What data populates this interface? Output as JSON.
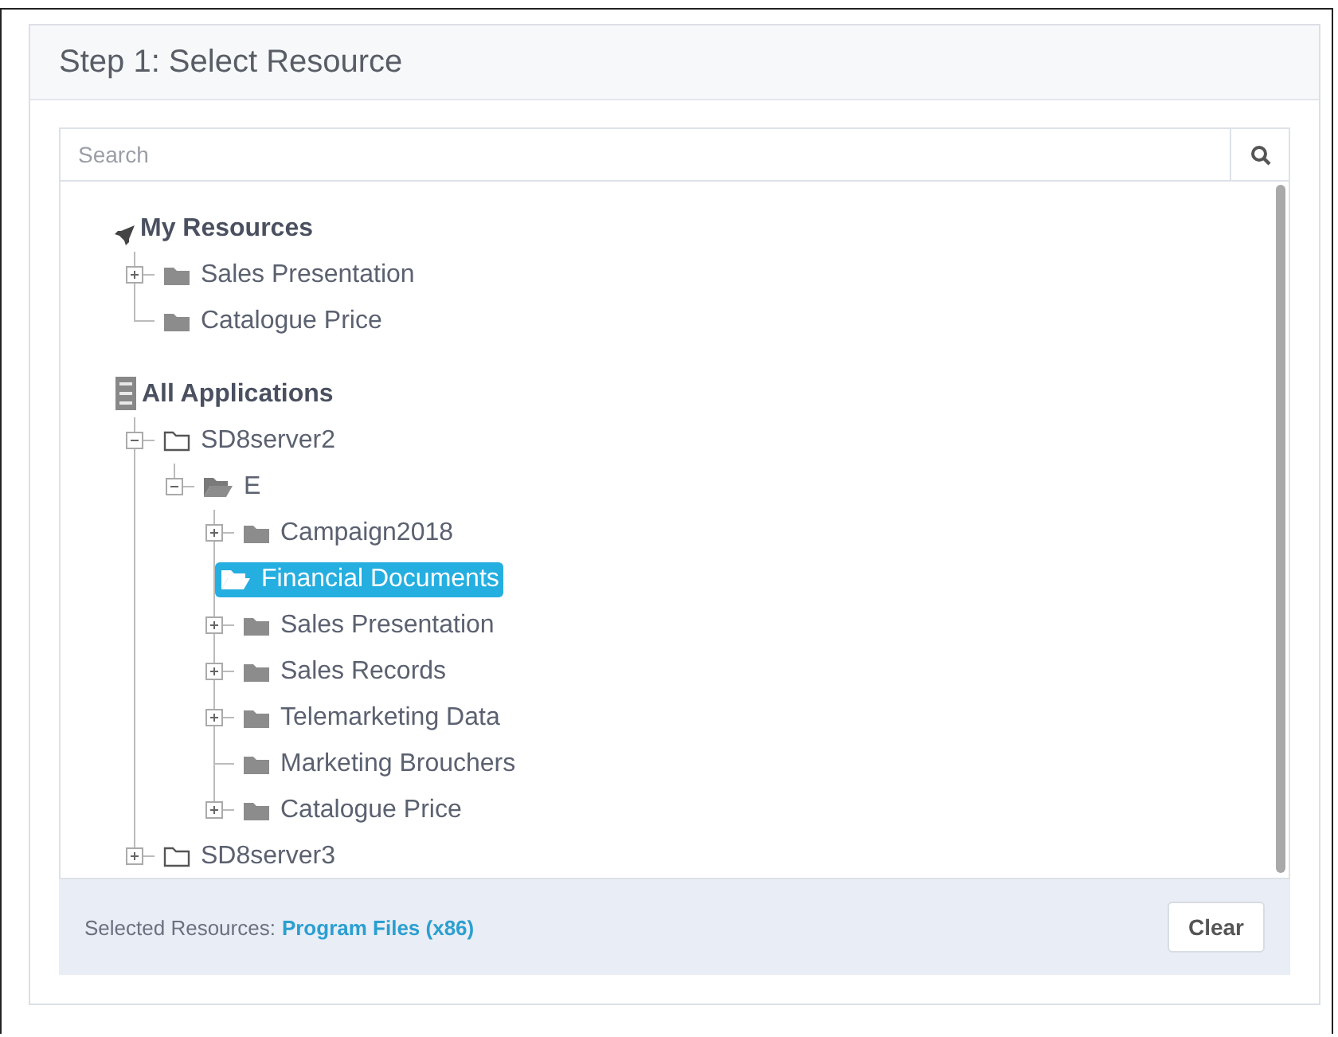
{
  "header": {
    "title": "Step 1: Select Resource"
  },
  "search": {
    "placeholder": "Search"
  },
  "sections": [
    {
      "kind": "resources",
      "label": "My Resources",
      "children": [
        {
          "label": "Sales Presentation",
          "kind": "folder",
          "expanded": false,
          "selected": false
        },
        {
          "label": "Catalogue Price",
          "kind": "folder",
          "selected": false
        }
      ]
    },
    {
      "kind": "applications",
      "label": "All Applications",
      "children": [
        {
          "label": "SD8server2",
          "kind": "outline",
          "expanded": true,
          "selected": false,
          "children": [
            {
              "label": "E",
              "kind": "open",
              "expanded": true,
              "selected": false,
              "children": [
                {
                  "label": "Campaign2018",
                  "kind": "folder",
                  "expanded": false,
                  "selected": false
                },
                {
                  "label": "Financial Documents",
                  "kind": "open",
                  "selected": true
                },
                {
                  "label": "Sales Presentation",
                  "kind": "folder",
                  "expanded": false,
                  "selected": false
                },
                {
                  "label": "Sales Records",
                  "kind": "folder",
                  "expanded": false,
                  "selected": false
                },
                {
                  "label": "Telemarketing Data",
                  "kind": "folder",
                  "expanded": false,
                  "selected": false
                },
                {
                  "label": "Marketing Brouchers",
                  "kind": "folder",
                  "selected": false
                },
                {
                  "label": "Catalogue Price",
                  "kind": "folder",
                  "expanded": false,
                  "selected": false
                }
              ]
            }
          ]
        },
        {
          "label": "SD8server3",
          "kind": "outline",
          "expanded": false,
          "selected": false
        }
      ]
    }
  ],
  "footer": {
    "label": "Selected Resources:",
    "value": "Program Files (x86)",
    "button": "Clear"
  }
}
